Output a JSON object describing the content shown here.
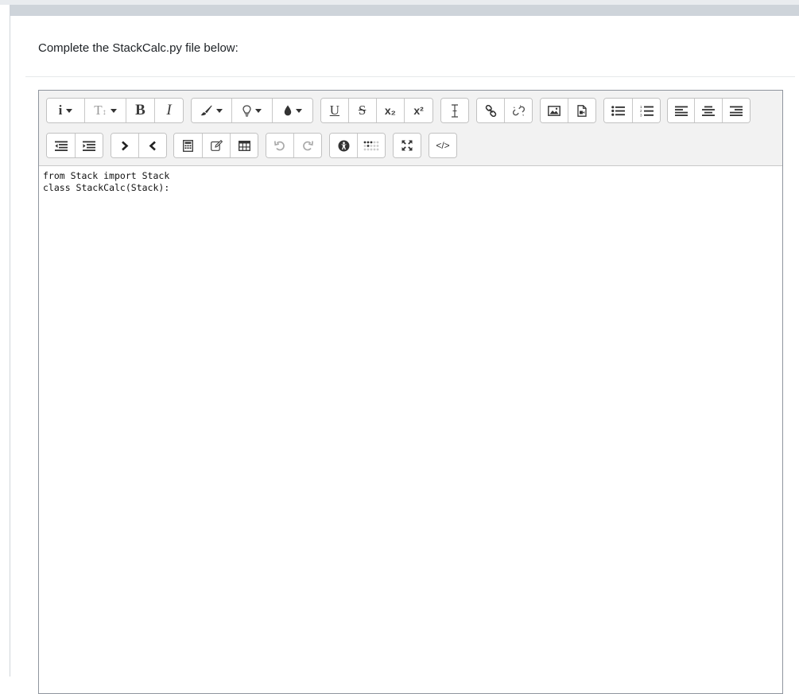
{
  "question": {
    "prompt": "Complete the StackCalc.py file below:"
  },
  "toolbar": {
    "superscript_label": "x²",
    "subscript_label": "x₂",
    "html_label": "</>",
    "bold_label": "B",
    "italic_label": "I",
    "underline_label": "U",
    "strike_label": "S"
  },
  "editor": {
    "lines": [
      "from Stack import Stack",
      "class StackCalc(Stack):"
    ]
  }
}
